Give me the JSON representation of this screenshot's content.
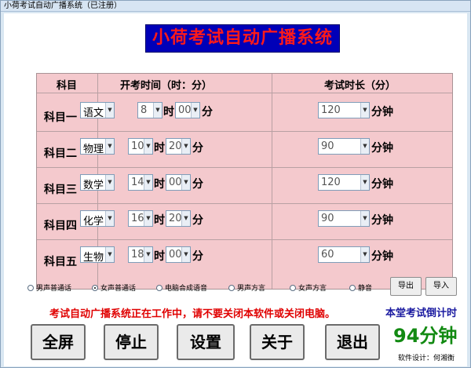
{
  "window": {
    "title": "小荷考试自动广播系统（已注册）"
  },
  "banner": "小荷考试自动广播系统",
  "table": {
    "headers": {
      "subject": "科目",
      "start": "开考时间（时：分）",
      "duration": "考试时长（分）"
    },
    "hour_unit": "时",
    "minute_unit": "分",
    "duration_unit": "分钟",
    "rows": [
      {
        "label": "科目一",
        "subject": "语文",
        "hour": "8",
        "minute": "00",
        "duration": "120"
      },
      {
        "label": "科目二",
        "subject": "物理",
        "hour": "10",
        "minute": "20",
        "duration": "90"
      },
      {
        "label": "科目三",
        "subject": "数学",
        "hour": "14",
        "minute": "00",
        "duration": "120"
      },
      {
        "label": "科目四",
        "subject": "化学",
        "hour": "16",
        "minute": "20",
        "duration": "90"
      },
      {
        "label": "科目五",
        "subject": "生物",
        "hour": "18",
        "minute": "00",
        "duration": "60"
      }
    ]
  },
  "voice_options": [
    "男声普通话",
    "女声普通话",
    "电脑合成语音",
    "男声方言",
    "女声方言",
    "静音"
  ],
  "voice_selected_index": 1,
  "buttons": {
    "export": "导出",
    "import": "导入",
    "fullscreen": "全屏",
    "stop": "停止",
    "settings": "设置",
    "about": "关于",
    "exit": "退出"
  },
  "status_message": "考试自动广播系统正在工作中，请不要关闭本软件或关闭电脑。",
  "countdown": {
    "label": "本堂考试倒计时",
    "value": "94分钟"
  },
  "designer": "软件设计：何湘衡"
}
